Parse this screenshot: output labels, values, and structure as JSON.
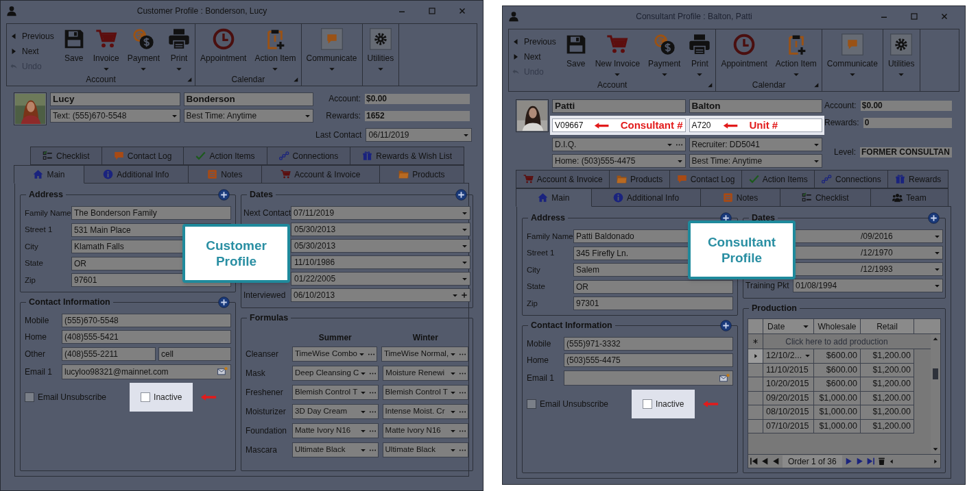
{
  "windows": [
    {
      "title": "Customer Profile : Bonderson, Lucy",
      "ribbon": {
        "groups": [
          {
            "label": "Account",
            "nav": [
              {
                "label": "Previous",
                "disabled": false
              },
              {
                "label": "Next",
                "disabled": false
              },
              {
                "label": "Undo",
                "disabled": true
              }
            ],
            "buttons": [
              {
                "label": "Save",
                "dropdown": false
              },
              {
                "label": "Invoice",
                "dropdown": true
              },
              {
                "label": "Payment",
                "dropdown": true
              },
              {
                "label": "Print",
                "dropdown": true
              }
            ]
          },
          {
            "label": "Calendar",
            "buttons": [
              {
                "label": "Appointment",
                "dropdown": false
              },
              {
                "label": "Action Item",
                "dropdown": true
              }
            ]
          },
          {
            "buttons": [
              {
                "label": "Communicate",
                "dropdown": true
              }
            ]
          },
          {
            "buttons": [
              {
                "label": "Utilities",
                "dropdown": true
              }
            ]
          }
        ]
      },
      "header": {
        "first_name": "Lucy",
        "last_name": "Bonderson",
        "rows": [
          [
            {
              "kind": "select",
              "value": "Text: (555)670-5548",
              "ellipsis": false
            },
            {
              "kind": "select",
              "value": "Best Time: Anytime",
              "ellipsis": false
            }
          ]
        ],
        "stats": [
          {
            "label": "Account:",
            "value": "$0.00",
            "kind": "box"
          },
          {
            "label": "Rewards:",
            "value": "1652",
            "kind": "box"
          },
          {
            "label": "Last Contact",
            "value": "06/11/2019",
            "kind": "select"
          }
        ]
      },
      "tabs": [
        [
          {
            "label": "Checklist",
            "kind": "checklist",
            "selected": false
          },
          {
            "label": "Contact Log",
            "kind": "chat",
            "selected": false
          },
          {
            "label": "Action Items",
            "kind": "check",
            "selected": false
          },
          {
            "label": "Connections",
            "kind": "connections",
            "selected": false
          },
          {
            "label": "Rewards & Wish List",
            "kind": "gift",
            "selected": false
          }
        ],
        [
          {
            "label": "Main",
            "kind": "home",
            "selected": true
          },
          {
            "label": "Additional Info",
            "kind": "info",
            "selected": false
          },
          {
            "label": "Notes",
            "kind": "notes",
            "selected": false
          },
          {
            "label": "Account & Invoice",
            "kind": "cart",
            "selected": false
          },
          {
            "label": "Products",
            "kind": "folder",
            "selected": false
          }
        ]
      ],
      "address": {
        "title": "Address",
        "fields": [
          {
            "label": "Family Name",
            "value": "The Bonderson Family"
          },
          {
            "label": "Street 1",
            "value": "531 Main Place"
          },
          {
            "label": "City",
            "value": "Klamath Falls"
          },
          {
            "label": "State",
            "value": "OR"
          },
          {
            "label": "Zip",
            "value": "97601"
          }
        ]
      },
      "contact": {
        "title": "Contact Information",
        "fields": [
          {
            "kind": "text",
            "label": "Mobile",
            "value": "(555)670-5548"
          },
          {
            "kind": "text",
            "label": "Home",
            "value": "(408)555-5421"
          },
          {
            "kind": "text",
            "label": "Other",
            "value": "(408)555-2211",
            "extra": "cell"
          },
          {
            "kind": "email",
            "label": "Email 1",
            "value": "lucyloo98321@mainnet.com"
          }
        ],
        "checkboxes": [
          {
            "label": "Email Unsubscribe",
            "checked": false,
            "highlighted": false
          },
          {
            "label": "Inactive",
            "checked": false,
            "highlighted": true
          }
        ]
      },
      "dates": {
        "title": "Dates",
        "fields": [
          {
            "label": "Next Contact",
            "value": "07/11/2019",
            "plus": false
          },
          {
            "value": "05/30/2013",
            "plus": false
          },
          {
            "value": "05/30/2013",
            "plus": false
          },
          {
            "value": "11/10/1986",
            "plus": false
          },
          {
            "value": "01/22/2005",
            "plus": false
          },
          {
            "label": "Interviewed",
            "value": "06/10/2013",
            "plus": true
          }
        ]
      },
      "side": {
        "kind": "formulas",
        "title": "Formulas",
        "columns": [
          "Summer",
          "Winter"
        ],
        "rows": [
          {
            "label": "Cleanser",
            "values": [
              "TimeWise Combo",
              "TimeWise Normal,"
            ]
          },
          {
            "label": "Mask",
            "values": [
              "Deep Cleansing C",
              "Moisture Renewi"
            ]
          },
          {
            "label": "Freshener",
            "values": [
              "Blemish Control T",
              "Blemish Control T"
            ]
          },
          {
            "label": "Moisturizer",
            "values": [
              "3D Day Cream",
              "Intense Moist. Cr"
            ]
          },
          {
            "label": "Foundation",
            "values": [
              "Matte Ivory N16",
              "Matte Ivory N16"
            ]
          },
          {
            "label": "Mascara",
            "values": [
              "Ultimate Black",
              "Ultimate Black"
            ]
          }
        ]
      },
      "callout": "Customer Profile"
    },
    {
      "title": "Consultant Profile : Balton, Patti",
      "ribbon": {
        "groups": [
          {
            "label": "Account",
            "nav": [
              {
                "label": "Previous",
                "disabled": false
              },
              {
                "label": "Next",
                "disabled": false
              },
              {
                "label": "Undo",
                "disabled": true
              }
            ],
            "buttons": [
              {
                "label": "Save",
                "dropdown": false
              },
              {
                "label": "New Invoice",
                "dropdown": true
              },
              {
                "label": "Payment",
                "dropdown": true
              },
              {
                "label": "Print",
                "dropdown": true
              }
            ]
          },
          {
            "label": "Calendar",
            "buttons": [
              {
                "label": "Appointment",
                "dropdown": false
              },
              {
                "label": "Action Item",
                "dropdown": true
              }
            ]
          },
          {
            "buttons": [
              {
                "label": "Communicate",
                "dropdown": true
              }
            ]
          },
          {
            "buttons": [
              {
                "label": "Utilities",
                "dropdown": true
              }
            ]
          }
        ]
      },
      "header": {
        "first_name": "Patti",
        "last_name": "Balton",
        "rows": [
          [
            {
              "kind": "highlight",
              "value": "V09667",
              "annotation": "Consultant #"
            },
            {
              "kind": "highlight",
              "value": "A720",
              "annotation": "Unit #"
            }
          ],
          [
            {
              "kind": "select",
              "value": "D.I.Q.",
              "ellipsis": true
            },
            {
              "kind": "select",
              "value": "Recruiter: DD5041",
              "ellipsis": false
            }
          ],
          [
            {
              "kind": "select",
              "value": "Home: (503)555-4475",
              "ellipsis": false
            },
            {
              "kind": "select",
              "value": "Best Time: Anytime",
              "ellipsis": false
            }
          ]
        ],
        "stats": [
          {
            "label": "Account:",
            "value": "$0.00",
            "kind": "box"
          },
          {
            "label": "Rewards:",
            "value": "0",
            "kind": "box"
          },
          {
            "label": "Level:",
            "value": "FORMER CONSULTAN",
            "kind": "box"
          }
        ]
      },
      "tabs": [
        [
          {
            "label": "Account & Invoice",
            "kind": "cart",
            "selected": false
          },
          {
            "label": "Products",
            "kind": "folder",
            "selected": false
          },
          {
            "label": "Contact Log",
            "kind": "chat",
            "selected": false
          },
          {
            "label": "Action Items",
            "kind": "check",
            "selected": false
          },
          {
            "label": "Connections",
            "kind": "connections",
            "selected": false
          },
          {
            "label": "Rewards",
            "kind": "gift",
            "selected": false
          }
        ],
        [
          {
            "label": "Main",
            "kind": "home",
            "selected": true
          },
          {
            "label": "Additional Info",
            "kind": "info",
            "selected": false
          },
          {
            "label": "Notes",
            "kind": "notes",
            "selected": false
          },
          {
            "label": "Checklist",
            "kind": "checklist",
            "selected": false
          },
          {
            "label": "Team",
            "kind": "team",
            "selected": false
          }
        ]
      ],
      "address": {
        "title": "Address",
        "fields": [
          {
            "label": "Family Name",
            "value": "Patti Baldonado"
          },
          {
            "label": "Street 1",
            "value": "345 Firefly Ln."
          },
          {
            "label": "City",
            "value": "Salem"
          },
          {
            "label": "State",
            "value": "OR"
          },
          {
            "label": "Zip",
            "value": "97301"
          }
        ]
      },
      "contact": {
        "title": "Contact Information",
        "fields": [
          {
            "kind": "text",
            "label": "Mobile",
            "value": "(555)971-3332"
          },
          {
            "kind": "text",
            "label": "Home",
            "value": "(503)555-4475"
          },
          {
            "kind": "email",
            "label": "Email 1"
          }
        ],
        "checkboxes": [
          {
            "label": "Email Unsubscribe",
            "checked": false,
            "highlighted": false
          },
          {
            "label": "Inactive",
            "checked": false,
            "highlighted": true
          }
        ]
      },
      "dates": {
        "title": "Dates",
        "fields": [
          {
            "value": "/09/2016",
            "plus": false
          },
          {
            "value": "/12/1970",
            "plus": false
          },
          {
            "value": "/12/1993",
            "plus": false
          },
          {
            "label": "Training Pkt",
            "value": "01/08/1994",
            "plus": false
          }
        ]
      },
      "side": {
        "kind": "production",
        "title": "Production",
        "columns": [
          "Date",
          "Wholesale",
          "Retail"
        ],
        "new_row": "Click here to add production",
        "rows": [
          {
            "values": [
              "12/10/2...",
              "$600.00",
              "$1,200.00"
            ],
            "selected": true
          },
          {
            "values": [
              "11/10/2015",
              "$600.00",
              "$1,200.00"
            ],
            "selected": false
          },
          {
            "values": [
              "10/20/2015",
              "$600.00",
              "$1,200.00"
            ],
            "selected": false
          },
          {
            "values": [
              "09/20/2015",
              "$1,000.00",
              "$1,200.00"
            ],
            "selected": false
          },
          {
            "values": [
              "08/10/2015",
              "$1,000.00",
              "$1,200.00"
            ],
            "selected": false
          },
          {
            "values": [
              "07/10/2015",
              "$1,000.00",
              "$1,200.00"
            ],
            "selected": false
          }
        ],
        "pager": "Order 1 of 36"
      },
      "callout": "Consultant Profile"
    }
  ]
}
